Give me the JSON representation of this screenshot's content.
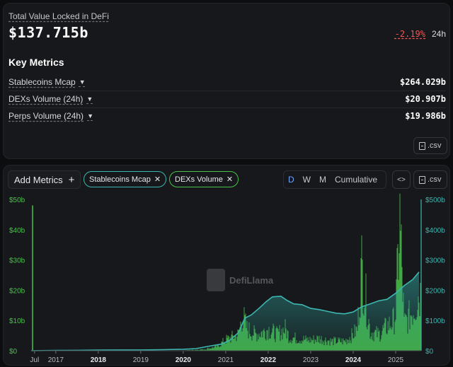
{
  "tvl": {
    "label": "Total Value Locked in DeFi",
    "value": "$137.715b",
    "change": "-2.19%",
    "period": "24h"
  },
  "key_metrics": {
    "title": "Key Metrics",
    "items": [
      {
        "label": "Stablecoins Mcap",
        "value": "$264.029b"
      },
      {
        "label": "DEXs Volume (24h)",
        "value": "$20.907b"
      },
      {
        "label": "Perps Volume (24h)",
        "value": "$19.986b"
      }
    ],
    "csv_label": ".csv"
  },
  "toolbar": {
    "add_metrics_label": "Add Metrics",
    "chips": [
      {
        "label": "Stablecoins Mcap",
        "color": "#3cb6b0"
      },
      {
        "label": "DEXs Volume",
        "color": "#49c24b"
      }
    ],
    "periods": [
      "D",
      "W",
      "M",
      "Cumulative"
    ],
    "active_period": "D",
    "embed_label": "<>",
    "csv_label": ".csv"
  },
  "watermark": "DefiLlama",
  "chart_data": {
    "type": "area",
    "x_ticks": [
      {
        "label": "Jul",
        "bold": false
      },
      {
        "label": "2017",
        "bold": false
      },
      {
        "label": "2018",
        "bold": true
      },
      {
        "label": "2019",
        "bold": false
      },
      {
        "label": "2020",
        "bold": true
      },
      {
        "label": "2021",
        "bold": false
      },
      {
        "label": "2022",
        "bold": true
      },
      {
        "label": "2023",
        "bold": false
      },
      {
        "label": "2024",
        "bold": true
      },
      {
        "label": "2025",
        "bold": false
      }
    ],
    "y_left_ticks": [
      "$0",
      "$10b",
      "$20b",
      "$30b",
      "$40b",
      "$50b"
    ],
    "y_right_ticks": [
      "$0",
      "$100b",
      "$200b",
      "$300b",
      "$400b",
      "$500b"
    ],
    "ylim_left": [
      0,
      50
    ],
    "ylim_right": [
      0,
      500
    ],
    "xlim": [
      2016.42,
      2025.6
    ],
    "grid": false,
    "series": [
      {
        "name": "Stablecoins Mcap",
        "axis": "right",
        "color": "#3cb6b0",
        "x": [
          2016.42,
          2017.0,
          2017.5,
          2018.0,
          2018.5,
          2019.0,
          2019.5,
          2020.0,
          2020.3,
          2020.6,
          2020.9,
          2021.1,
          2021.3,
          2021.45,
          2021.6,
          2021.8,
          2021.95,
          2022.1,
          2022.3,
          2022.45,
          2022.6,
          2022.8,
          2023.0,
          2023.2,
          2023.4,
          2023.6,
          2023.8,
          2024.0,
          2024.2,
          2024.4,
          2024.6,
          2024.8,
          2025.0,
          2025.2,
          2025.4,
          2025.55
        ],
        "values": [
          0.3,
          1,
          1.3,
          2,
          2.6,
          2.6,
          3.5,
          5,
          7,
          15,
          22,
          35,
          60,
          108,
          118,
          142,
          162,
          178,
          180,
          166,
          155,
          152,
          140,
          136,
          130,
          124,
          122,
          128,
          145,
          155,
          165,
          170,
          190,
          215,
          235,
          260
        ]
      },
      {
        "name": "DEXs Volume",
        "axis": "left",
        "color": "#49c24b",
        "x": [
          2016.42,
          2016.5,
          2017.0,
          2018.0,
          2019.0,
          2020.0,
          2020.5,
          2020.8,
          2021.0,
          2021.15,
          2021.3,
          2021.4,
          2021.5,
          2021.7,
          2021.9,
          2022.0,
          2022.2,
          2022.4,
          2022.5,
          2022.7,
          2022.9,
          2023.0,
          2023.2,
          2023.5,
          2023.8,
          2024.0,
          2024.1,
          2024.2,
          2024.4,
          2024.6,
          2024.8,
          2024.95,
          2025.0,
          2025.1,
          2025.2,
          2025.3,
          2025.45,
          2025.55
        ],
        "values": [
          48,
          0,
          0,
          0,
          0,
          0.1,
          0.5,
          1.5,
          4,
          5,
          6,
          13,
          8,
          6,
          7,
          8,
          6,
          8,
          5,
          4.5,
          4,
          4,
          4.5,
          3.5,
          3.5,
          6,
          8,
          31,
          7,
          6,
          9,
          11,
          14,
          48,
          10,
          12,
          16,
          21
        ]
      }
    ]
  }
}
